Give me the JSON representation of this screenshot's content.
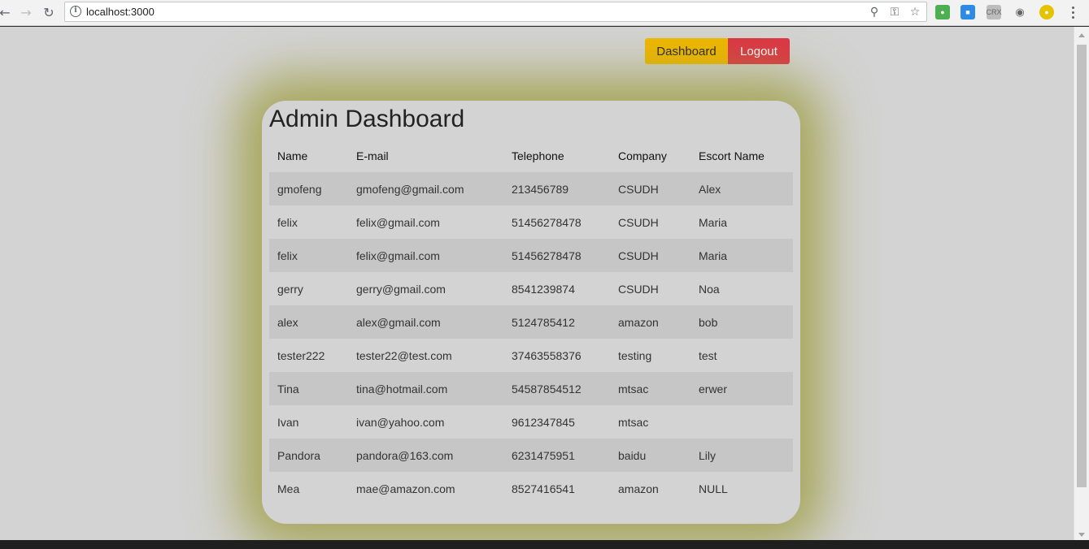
{
  "browser": {
    "url": "localhost:3000"
  },
  "header": {
    "dashboard_label": "Dashboard",
    "logout_label": "Logout"
  },
  "main": {
    "title": "Admin Dashboard",
    "columns": [
      "Name",
      "E-mail",
      "Telephone",
      "Company",
      "Escort Name"
    ],
    "rows": [
      [
        "gmofeng",
        "gmofeng@gmail.com",
        "213456789",
        "CSUDH",
        "Alex"
      ],
      [
        "felix",
        "felix@gmail.com",
        "51456278478",
        "CSUDH",
        "Maria"
      ],
      [
        "felix",
        "felix@gmail.com",
        "51456278478",
        "CSUDH",
        "Maria"
      ],
      [
        "gerry",
        "gerry@gmail.com",
        "8541239874",
        "CSUDH",
        "Noa"
      ],
      [
        "alex",
        "alex@gmail.com",
        "5124785412",
        "amazon",
        "bob"
      ],
      [
        "tester222",
        "tester22@test.com",
        "37463558376",
        "testing",
        "test"
      ],
      [
        "Tina",
        "tina@hotmail.com",
        "54587854512",
        "mtsac",
        "erwer"
      ],
      [
        "Ivan",
        "ivan@yahoo.com",
        "9612347845",
        "mtsac",
        ""
      ],
      [
        "Pandora",
        "pandora@163.com",
        "6231475951",
        "baidu",
        "Lily"
      ],
      [
        "Mea",
        "mae@amazon.com",
        "8527416541",
        "amazon",
        "NULL"
      ]
    ]
  },
  "colors": {
    "dashboard_button": "#f0b700",
    "logout_button": "#dc3545",
    "page_background": "#d3d3d3",
    "card_glow": "#9b9b3c"
  }
}
